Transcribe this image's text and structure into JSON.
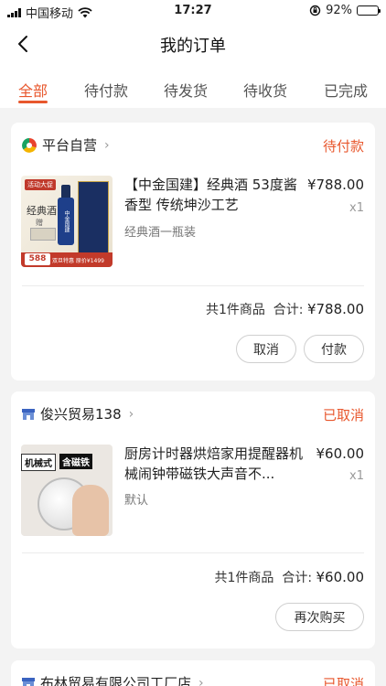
{
  "status_bar": {
    "carrier": "中国移动",
    "time": "17:27",
    "battery": "92%",
    "battery_level": 0.92
  },
  "header": {
    "title": "我的订单"
  },
  "tabs": [
    {
      "label": "全部",
      "active": true
    },
    {
      "label": "待付款",
      "active": false
    },
    {
      "label": "待发货",
      "active": false
    },
    {
      "label": "待收货",
      "active": false
    },
    {
      "label": "已完成",
      "active": false
    }
  ],
  "orders": [
    {
      "shop": "平台自营",
      "status": "待付款",
      "product": {
        "name": "【中金国建】经典酒 53度酱香型 传统坤沙工艺",
        "spec": "经典酒一瓶装",
        "price": "¥788.00",
        "qty": "x1",
        "thumb": {
          "badge": "活动大促",
          "title": "经典酒",
          "sub": "赠",
          "bottle_label": "中金国建",
          "price": "588",
          "footer": "双旦特惠 原价¥1499"
        }
      },
      "count_text": "共1件商品",
      "total_label": "合计:",
      "total": "¥788.00",
      "buttons": [
        "取消",
        "付款"
      ]
    },
    {
      "shop": "俊兴贸易138",
      "status": "已取消",
      "product": {
        "name": "厨房计时器烘焙家用提醒器机械闹钟带磁铁大声音不...",
        "spec": "默认",
        "price": "¥60.00",
        "qty": "x1",
        "thumb": {
          "tag1": "机械式",
          "tag2": "含磁铁"
        }
      },
      "count_text": "共1件商品",
      "total_label": "合计:",
      "total": "¥60.00",
      "buttons": [
        "再次购买"
      ]
    },
    {
      "shop": "布林贸易有限公司工厂店",
      "status": "已取消"
    }
  ],
  "colors": {
    "accent": "#e8572d",
    "background": "#f3f3f3"
  }
}
